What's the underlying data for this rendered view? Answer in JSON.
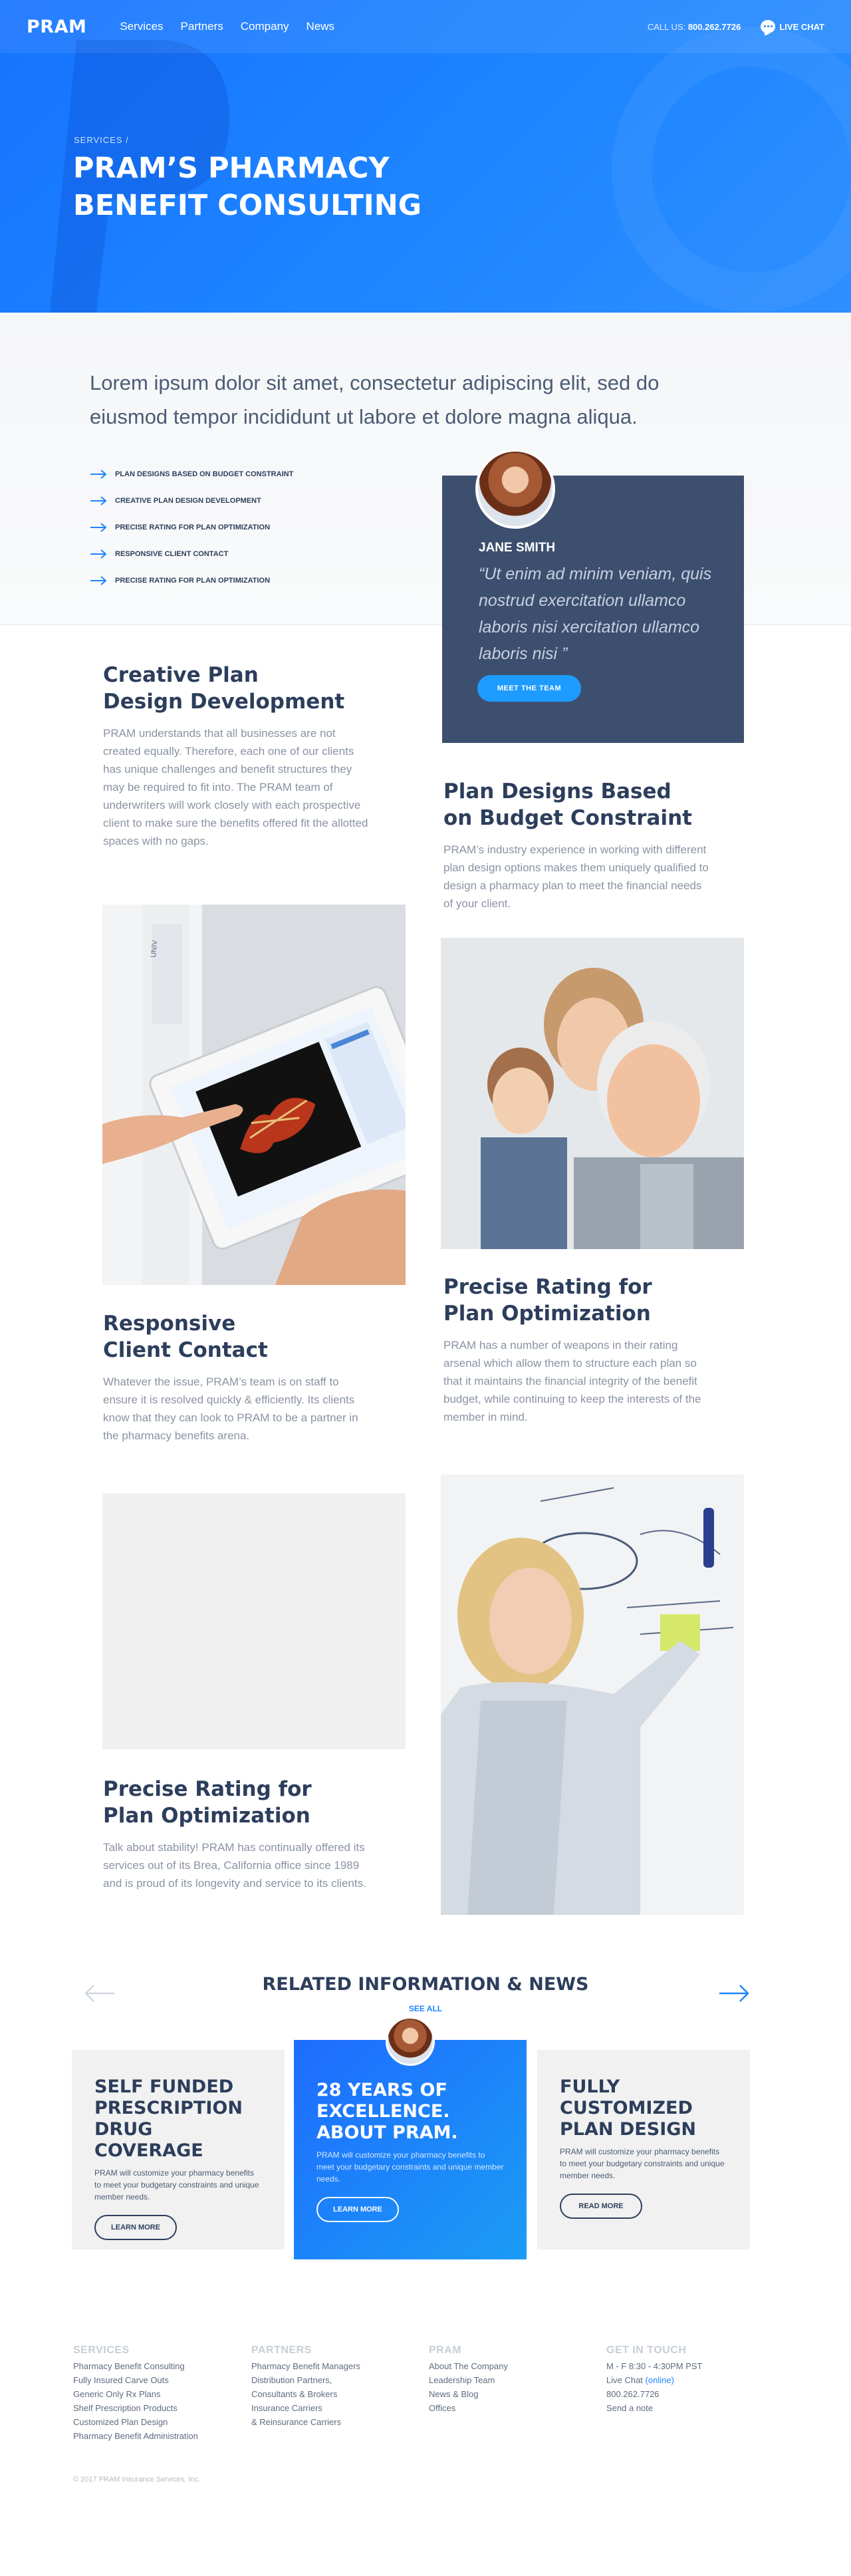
{
  "nav": {
    "logo": "PRAM",
    "links": [
      "Services",
      "Partners",
      "Company",
      "News"
    ],
    "call_prefix": "CALL US:",
    "call_number": "800.262.7726",
    "chat_label": "LIVE CHAT"
  },
  "hero": {
    "breadcrumb": "SERVICES /",
    "title_line1": "PRAM’S PHARMACY",
    "title_line2": "BENEFIT CONSULTING"
  },
  "intro": {
    "lead": "Lorem ipsum dolor sit amet, consectetur adipiscing elit, sed do eiusmod tempor incididunt ut labore et dolore magna aliqua.",
    "checklist": [
      "PLAN DESIGNS BASED ON BUDGET CONSTRAINT",
      "CREATIVE PLAN DESIGN DEVELOPMENT",
      "PRECISE RATING FOR PLAN OPTIMIZATION",
      "RESPONSIVE CLIENT CONTACT",
      "PRECISE RATING FOR PLAN OPTIMIZATION"
    ]
  },
  "quote_card": {
    "name": "JANE SMITH",
    "quote": "“Ut enim ad minim veniam, quis nostrud exercitation ullamco laboris nisi xercitation ullamco laboris nisi ”",
    "button": "MEET THE TEAM"
  },
  "features": [
    {
      "title_line1": "Creative Plan",
      "title_line2": "Design Development",
      "body": "PRAM understands that all businesses are not created equally. Therefore, each one of our clients has unique challenges and benefit structures they may be required to fit into. The PRAM team of underwriters will work closely with each prospective client to make sure the benefits offered fit the allotted spaces with no gaps."
    },
    {
      "title_line1": "Plan Designs Based",
      "title_line2": "on Budget Constraint",
      "body": "PRAM’s industry experience in working with different plan design options makes them uniquely qualified to design a pharmacy plan to meet the financial needs of your client."
    },
    {
      "title_line1": "Responsive",
      "title_line2": "Client Contact",
      "body": "Whatever the issue, PRAM’s team is on staff to ensure it is resolved quickly & efficiently. Its clients know that they can look to PRAM to be a partner in the pharmacy benefits arena."
    },
    {
      "title_line1": "Precise Rating for",
      "title_line2": "Plan Optimization",
      "body": "PRAM has a number of weapons in their rating arsenal which allow them to structure each plan so that it maintains the financial integrity of the benefit budget, while continuing to keep the interests of the member in mind."
    },
    {
      "title_line1": "Precise Rating for",
      "title_line2": "Plan Optimization",
      "body": "Talk about stability! PRAM has continually offered its services out of its Brea, California office since 1989 and is proud of its longevity and service to its clients."
    }
  ],
  "images": {
    "tablet_label": "UNIV"
  },
  "news": {
    "title": "RELATED INFORMATION & NEWS",
    "see_all": "SEE ALL",
    "cards": [
      {
        "l1": "SELF FUNDED",
        "l2": "PRESCRIPTION",
        "l3": "DRUG COVERAGE",
        "body": "PRAM will customize your pharmacy benefits to meet your budgetary constraints and unique member needs.",
        "button": "LEARN MORE"
      },
      {
        "l1": "28 YEARS OF",
        "l2": "EXCELLENCE.",
        "l3": "ABOUT PRAM.",
        "body": "PRAM will customize your pharmacy benefits to meet your budgetary constraints and unique member needs.",
        "button": "LEARN MORE"
      },
      {
        "l1": "FULLY",
        "l2": "CUSTOMIZED",
        "l3": "PLAN DESIGN",
        "body": "PRAM will customize your pharmacy benefits to meet your budgetary constraints and unique member needs.",
        "button": "READ MORE"
      }
    ]
  },
  "footer": {
    "services": {
      "title": "SERVICES",
      "items": [
        "Pharmacy Benefit Consulting",
        "Fully Insured Carve Outs",
        "Generic Only Rx Plans",
        "Shelf Prescription Products",
        "Customized Plan Design",
        "Pharmacy Benefit Administration"
      ]
    },
    "partners": {
      "title": "PARTNERS",
      "items": [
        "Pharmacy Benefit Managers",
        "Distribution Partners,",
        "Consultants & Brokers",
        "Insurance Carriers",
        "& Reinsurance Carriers"
      ]
    },
    "pram": {
      "title": "PRAM",
      "items": [
        "About The Company",
        "Leadership Team",
        "News & Blog",
        "Offices"
      ]
    },
    "contact": {
      "title": "GET IN TOUCH",
      "hours": "M - F 8:30 - 4:30PM PST",
      "chat": "Live Chat",
      "online": "(online)",
      "phone": "800.262.7726",
      "note": "Send a note"
    },
    "copyright": "© 2017 PRAM Insurance Services, Inc."
  }
}
